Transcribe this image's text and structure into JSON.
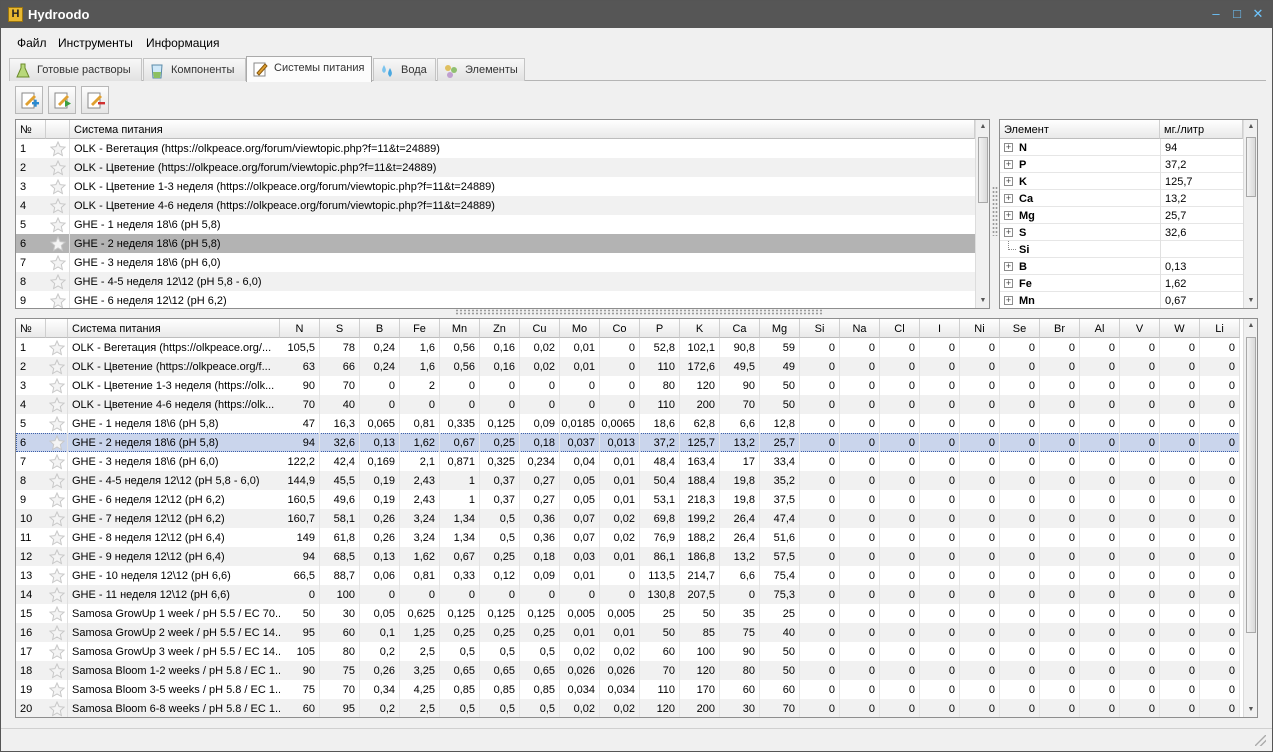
{
  "window": {
    "title": "Hydroodo",
    "app_letter": "H",
    "btn_min": "–",
    "btn_max": "□",
    "btn_close": "✕"
  },
  "menu": [
    "Файл",
    "Инструменты",
    "Информация"
  ],
  "tabs": [
    {
      "label": "Готовые растворы",
      "icon": "flask-icon"
    },
    {
      "label": "Компоненты",
      "icon": "beaker-icon"
    },
    {
      "label": "Системы питания",
      "icon": "notebook-icon"
    },
    {
      "label": "Вода",
      "icon": "water-drops-icon"
    },
    {
      "label": "Элементы",
      "icon": "elements-icon"
    }
  ],
  "active_tab": 2,
  "toolbar": [
    "add-system-button",
    "edit-system-button",
    "delete-system-button"
  ],
  "systems": {
    "headers": [
      "№",
      "",
      "Система питания"
    ],
    "selected": 6,
    "rows": [
      {
        "no": "1",
        "name": "OLK - Вегетация (https://olkpeace.org/forum/viewtopic.php?f=11&t=24889)"
      },
      {
        "no": "2",
        "name": "OLK - Цветение (https://olkpeace.org/forum/viewtopic.php?f=11&t=24889)"
      },
      {
        "no": "3",
        "name": "OLK - Цветение 1-3 неделя (https://olkpeace.org/forum/viewtopic.php?f=11&t=24889)"
      },
      {
        "no": "4",
        "name": "OLK - Цветение 4-6 неделя (https://olkpeace.org/forum/viewtopic.php?f=11&t=24889)"
      },
      {
        "no": "5",
        "name": "GHE - 1 неделя 18\\6 (pH 5,8)"
      },
      {
        "no": "6",
        "name": "GHE - 2 неделя 18\\6 (pH 5,8)"
      },
      {
        "no": "7",
        "name": "GHE - 3 неделя 18\\6 (pH 6,0)"
      },
      {
        "no": "8",
        "name": "GHE - 4-5 неделя 12\\12  (pH 5,8 - 6,0)"
      },
      {
        "no": "9",
        "name": "GHE - 6 неделя 12\\12 (pH 6,2)"
      }
    ]
  },
  "elements": {
    "headers": [
      "Элемент",
      "мг./литр"
    ],
    "rows": [
      {
        "name": "N",
        "value": "94",
        "expandable": true
      },
      {
        "name": "P",
        "value": "37,2",
        "expandable": true
      },
      {
        "name": "K",
        "value": "125,7",
        "expandable": true
      },
      {
        "name": "Ca",
        "value": "13,2",
        "expandable": true
      },
      {
        "name": "Mg",
        "value": "25,7",
        "expandable": true
      },
      {
        "name": "S",
        "value": "32,6",
        "expandable": true
      },
      {
        "name": "Si",
        "value": "",
        "expandable": false
      },
      {
        "name": "B",
        "value": "0,13",
        "expandable": true
      },
      {
        "name": "Fe",
        "value": "1,62",
        "expandable": true
      },
      {
        "name": "Mn",
        "value": "0,67",
        "expandable": true
      }
    ]
  },
  "grid": {
    "headers": [
      "№",
      "",
      "Система питания",
      "N",
      "S",
      "B",
      "Fe",
      "Mn",
      "Zn",
      "Cu",
      "Mo",
      "Co",
      "P",
      "K",
      "Ca",
      "Mg",
      "Si",
      "Na",
      "Cl",
      "I",
      "Ni",
      "Se",
      "Br",
      "Al",
      "V",
      "W",
      "Li"
    ],
    "selected": 6,
    "rows": [
      [
        "1",
        "OLK - Вегетация (https://olkpeace.org/...",
        "105,5",
        "78",
        "0,24",
        "1,6",
        "0,56",
        "0,16",
        "0,02",
        "0,01",
        "0",
        "52,8",
        "102,1",
        "90,8",
        "59",
        "0",
        "0",
        "0",
        "0",
        "0",
        "0",
        "0",
        "0",
        "0",
        "0",
        "0"
      ],
      [
        "2",
        "OLK - Цветение (https://olkpeace.org/f...",
        "63",
        "66",
        "0,24",
        "1,6",
        "0,56",
        "0,16",
        "0,02",
        "0,01",
        "0",
        "110",
        "172,6",
        "49,5",
        "49",
        "0",
        "0",
        "0",
        "0",
        "0",
        "0",
        "0",
        "0",
        "0",
        "0",
        "0"
      ],
      [
        "3",
        "OLK - Цветение 1-3 неделя (https://olk...",
        "90",
        "70",
        "0",
        "2",
        "0",
        "0",
        "0",
        "0",
        "0",
        "80",
        "120",
        "90",
        "50",
        "0",
        "0",
        "0",
        "0",
        "0",
        "0",
        "0",
        "0",
        "0",
        "0",
        "0"
      ],
      [
        "4",
        "OLK - Цветение 4-6 неделя (https://olk...",
        "70",
        "40",
        "0",
        "0",
        "0",
        "0",
        "0",
        "0",
        "0",
        "110",
        "200",
        "70",
        "50",
        "0",
        "0",
        "0",
        "0",
        "0",
        "0",
        "0",
        "0",
        "0",
        "0",
        "0"
      ],
      [
        "5",
        "GHE - 1 неделя 18\\6 (pH 5,8)",
        "47",
        "16,3",
        "0,065",
        "0,81",
        "0,335",
        "0,125",
        "0,09",
        "0,0185",
        "0,0065",
        "18,6",
        "62,8",
        "6,6",
        "12,8",
        "0",
        "0",
        "0",
        "0",
        "0",
        "0",
        "0",
        "0",
        "0",
        "0",
        "0"
      ],
      [
        "6",
        "GHE - 2 неделя 18\\6 (pH 5,8)",
        "94",
        "32,6",
        "0,13",
        "1,62",
        "0,67",
        "0,25",
        "0,18",
        "0,037",
        "0,013",
        "37,2",
        "125,7",
        "13,2",
        "25,7",
        "0",
        "0",
        "0",
        "0",
        "0",
        "0",
        "0",
        "0",
        "0",
        "0",
        "0"
      ],
      [
        "7",
        "GHE - 3 неделя 18\\6 (pH 6,0)",
        "122,2",
        "42,4",
        "0,169",
        "2,1",
        "0,871",
        "0,325",
        "0,234",
        "0,04",
        "0,01",
        "48,4",
        "163,4",
        "17",
        "33,4",
        "0",
        "0",
        "0",
        "0",
        "0",
        "0",
        "0",
        "0",
        "0",
        "0",
        "0"
      ],
      [
        "8",
        "GHE - 4-5 неделя 12\\12 (pH 5,8 - 6,0)",
        "144,9",
        "45,5",
        "0,19",
        "2,43",
        "1",
        "0,37",
        "0,27",
        "0,05",
        "0,01",
        "50,4",
        "188,4",
        "19,8",
        "35,2",
        "0",
        "0",
        "0",
        "0",
        "0",
        "0",
        "0",
        "0",
        "0",
        "0",
        "0"
      ],
      [
        "9",
        "GHE - 6 неделя 12\\12 (pH 6,2)",
        "160,5",
        "49,6",
        "0,19",
        "2,43",
        "1",
        "0,37",
        "0,27",
        "0,05",
        "0,01",
        "53,1",
        "218,3",
        "19,8",
        "37,5",
        "0",
        "0",
        "0",
        "0",
        "0",
        "0",
        "0",
        "0",
        "0",
        "0",
        "0"
      ],
      [
        "10",
        "GHE - 7 неделя 12\\12 (pH 6,2)",
        "160,7",
        "58,1",
        "0,26",
        "3,24",
        "1,34",
        "0,5",
        "0,36",
        "0,07",
        "0,02",
        "69,8",
        "199,2",
        "26,4",
        "47,4",
        "0",
        "0",
        "0",
        "0",
        "0",
        "0",
        "0",
        "0",
        "0",
        "0",
        "0"
      ],
      [
        "11",
        "GHE - 8 неделя 12\\12 (pH 6,4)",
        "149",
        "61,8",
        "0,26",
        "3,24",
        "1,34",
        "0,5",
        "0,36",
        "0,07",
        "0,02",
        "76,9",
        "188,2",
        "26,4",
        "51,6",
        "0",
        "0",
        "0",
        "0",
        "0",
        "0",
        "0",
        "0",
        "0",
        "0",
        "0"
      ],
      [
        "12",
        "GHE - 9 неделя 12\\12 (pH 6,4)",
        "94",
        "68,5",
        "0,13",
        "1,62",
        "0,67",
        "0,25",
        "0,18",
        "0,03",
        "0,01",
        "86,1",
        "186,8",
        "13,2",
        "57,5",
        "0",
        "0",
        "0",
        "0",
        "0",
        "0",
        "0",
        "0",
        "0",
        "0",
        "0"
      ],
      [
        "13",
        "GHE - 10 неделя 12\\12 (pH 6,6)",
        "66,5",
        "88,7",
        "0,06",
        "0,81",
        "0,33",
        "0,12",
        "0,09",
        "0,01",
        "0",
        "113,5",
        "214,7",
        "6,6",
        "75,4",
        "0",
        "0",
        "0",
        "0",
        "0",
        "0",
        "0",
        "0",
        "0",
        "0",
        "0"
      ],
      [
        "14",
        "GHE - 11 неделя 12\\12 (pH 6,6)",
        "0",
        "100",
        "0",
        "0",
        "0",
        "0",
        "0",
        "0",
        "0",
        "130,8",
        "207,5",
        "0",
        "75,3",
        "0",
        "0",
        "0",
        "0",
        "0",
        "0",
        "0",
        "0",
        "0",
        "0",
        "0"
      ],
      [
        "15",
        "Samosa GrowUp 1 week / pH 5.5 / EC 70...",
        "50",
        "30",
        "0,05",
        "0,625",
        "0,125",
        "0,125",
        "0,125",
        "0,005",
        "0,005",
        "25",
        "50",
        "35",
        "25",
        "0",
        "0",
        "0",
        "0",
        "0",
        "0",
        "0",
        "0",
        "0",
        "0",
        "0"
      ],
      [
        "16",
        "Samosa GrowUp 2 week / pH 5.5 / EC 14...",
        "95",
        "60",
        "0,1",
        "1,25",
        "0,25",
        "0,25",
        "0,25",
        "0,01",
        "0,01",
        "50",
        "85",
        "75",
        "40",
        "0",
        "0",
        "0",
        "0",
        "0",
        "0",
        "0",
        "0",
        "0",
        "0",
        "0"
      ],
      [
        "17",
        "Samosa GrowUp 3 week / pH 5.5 / EC 14...",
        "105",
        "80",
        "0,2",
        "2,5",
        "0,5",
        "0,5",
        "0,5",
        "0,02",
        "0,02",
        "60",
        "100",
        "90",
        "50",
        "0",
        "0",
        "0",
        "0",
        "0",
        "0",
        "0",
        "0",
        "0",
        "0",
        "0"
      ],
      [
        "18",
        "Samosa Bloom 1-2 weeks / pH 5.8 / EC 1...",
        "90",
        "75",
        "0,26",
        "3,25",
        "0,65",
        "0,65",
        "0,65",
        "0,026",
        "0,026",
        "70",
        "120",
        "80",
        "50",
        "0",
        "0",
        "0",
        "0",
        "0",
        "0",
        "0",
        "0",
        "0",
        "0",
        "0"
      ],
      [
        "19",
        "Samosa Bloom 3-5 weeks / pH 5.8 / EC 1...",
        "75",
        "70",
        "0,34",
        "4,25",
        "0,85",
        "0,85",
        "0,85",
        "0,034",
        "0,034",
        "110",
        "170",
        "60",
        "60",
        "0",
        "0",
        "0",
        "0",
        "0",
        "0",
        "0",
        "0",
        "0",
        "0",
        "0"
      ],
      [
        "20",
        "Samosa Bloom 6-8 weeks / pH 5.8 / EC 1...",
        "60",
        "95",
        "0,2",
        "2,5",
        "0,5",
        "0,5",
        "0,5",
        "0,02",
        "0,02",
        "120",
        "200",
        "30",
        "70",
        "0",
        "0",
        "0",
        "0",
        "0",
        "0",
        "0",
        "0",
        "0",
        "0",
        "0"
      ]
    ]
  },
  "colors": {
    "titlebar": "#565656",
    "selection_top": "#b3b3b3",
    "selection_grid": "#cad5ec",
    "star": "#c8c8c8"
  }
}
